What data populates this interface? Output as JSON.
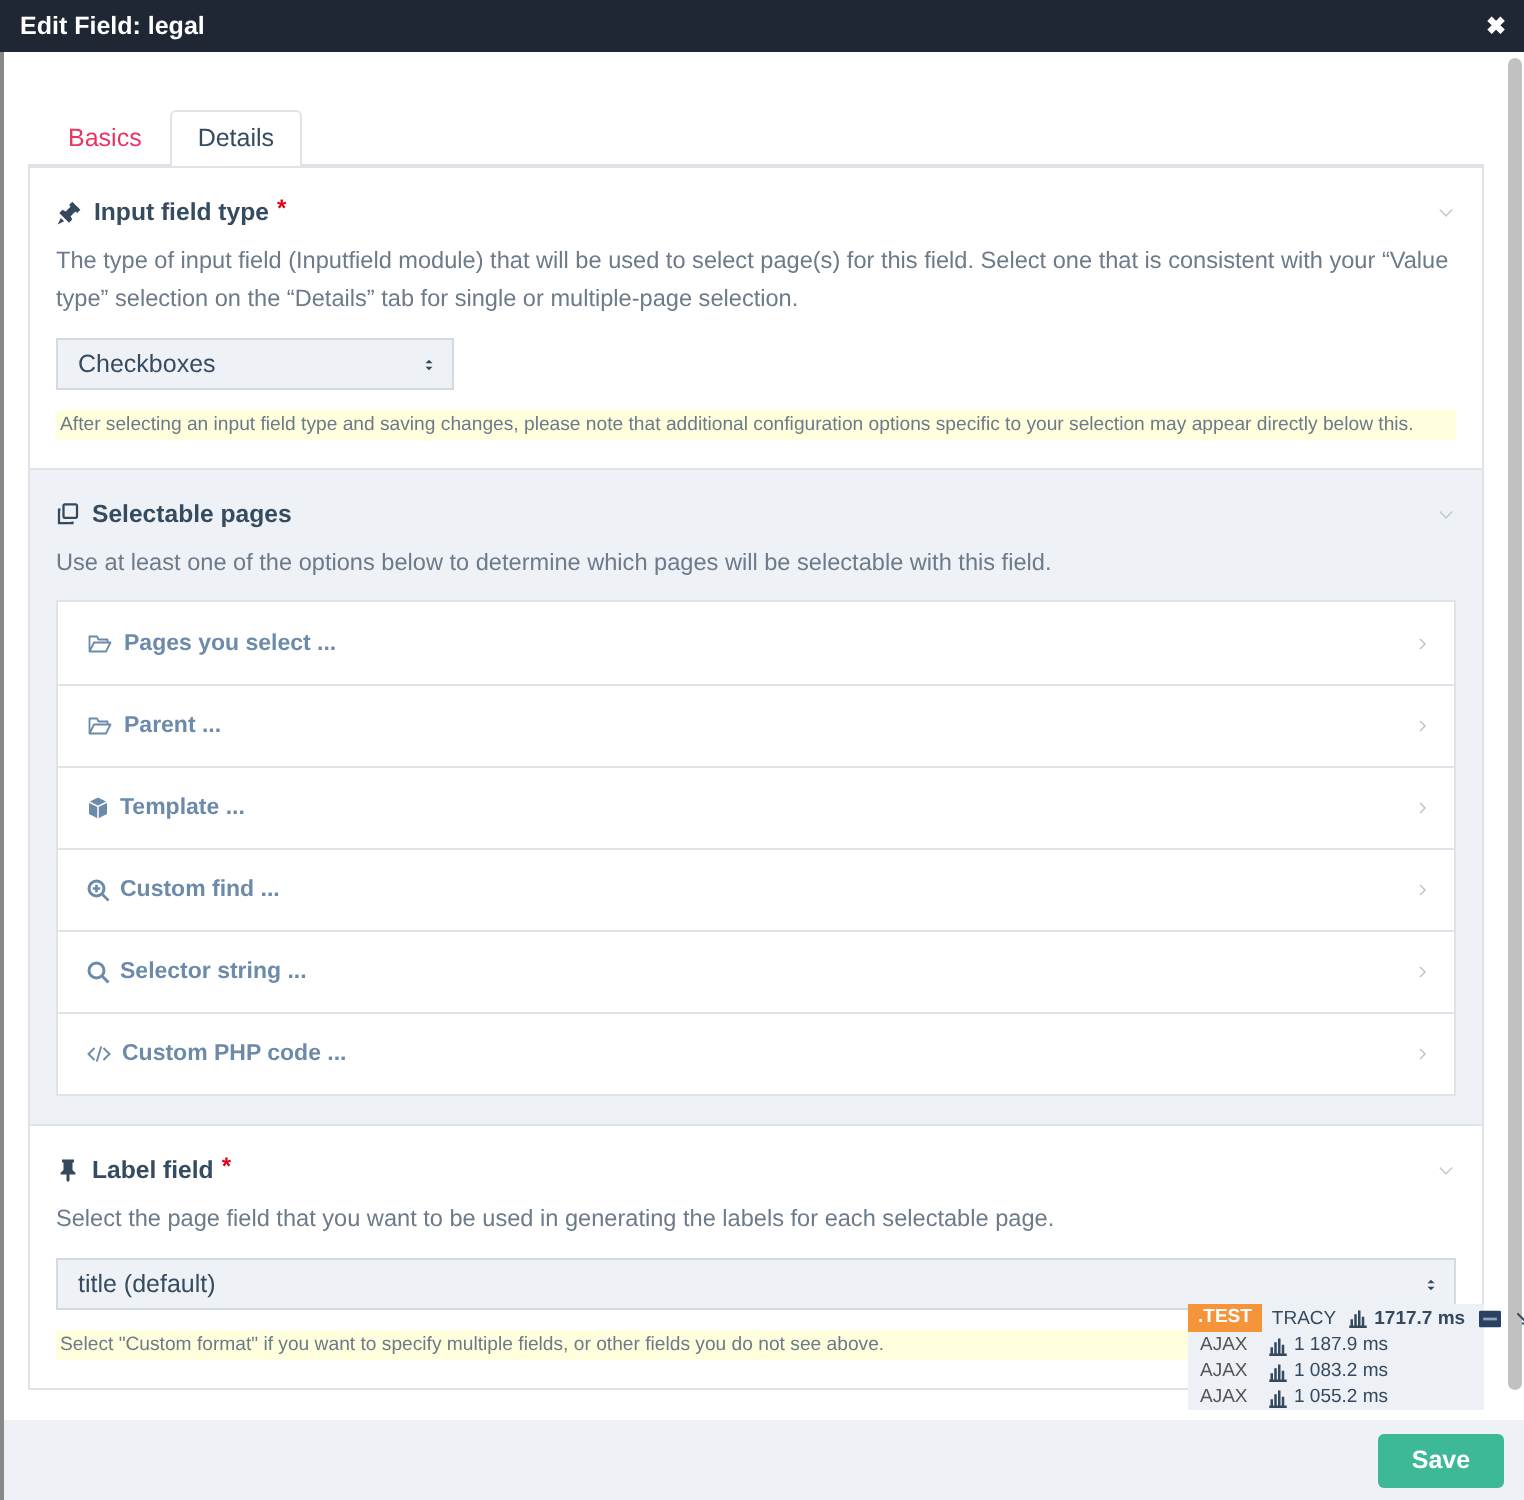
{
  "window": {
    "title": "Edit Field: legal",
    "close": "✖"
  },
  "required_mark": "*",
  "tabs": [
    {
      "label": "Basics",
      "selected": false
    },
    {
      "label": "Details",
      "selected": true
    }
  ],
  "sections": [
    {
      "kind": "select",
      "title": "Input field type",
      "required": true,
      "description": "The type of input field (Inputfield module) that will be used to select page(s) for this field. Select one that is consistent with your “Value type” selection on the “Details” tab for single or multiple-page selection.",
      "value": "Checkboxes",
      "note": "After selecting an input field type and saving changes, please note that additional configuration options specific to your selection may appear directly below this."
    },
    {
      "kind": "options",
      "title": "Selectable pages",
      "required": false,
      "description": "Use at least one of the options below to determine which pages will be selectable with this field.",
      "options": [
        {
          "label": "Pages you select ..."
        },
        {
          "label": "Parent ..."
        },
        {
          "label": "Template ..."
        },
        {
          "label": "Custom find ..."
        },
        {
          "label": "Selector string ..."
        },
        {
          "label": "Custom PHP code ..."
        }
      ]
    },
    {
      "kind": "select",
      "title": "Label field",
      "required": true,
      "description": "Select the page field that you want to be used in generating the labels for each selectable page.",
      "value": "title (default)",
      "note": "Select \"Custom format\" if you want to specify multiple fields, or other fields you do not see above."
    }
  ],
  "tracy": {
    "env": ".TEST",
    "name": "TRACY",
    "time": "1717.7 ms",
    "ajax": [
      {
        "label": "AJAX",
        "time": "1 187.9 ms"
      },
      {
        "label": "AJAX",
        "time": "1 083.2 ms"
      },
      {
        "label": "AJAX",
        "time": "1 055.2 ms"
      }
    ]
  },
  "footer": {
    "save": "Save"
  }
}
